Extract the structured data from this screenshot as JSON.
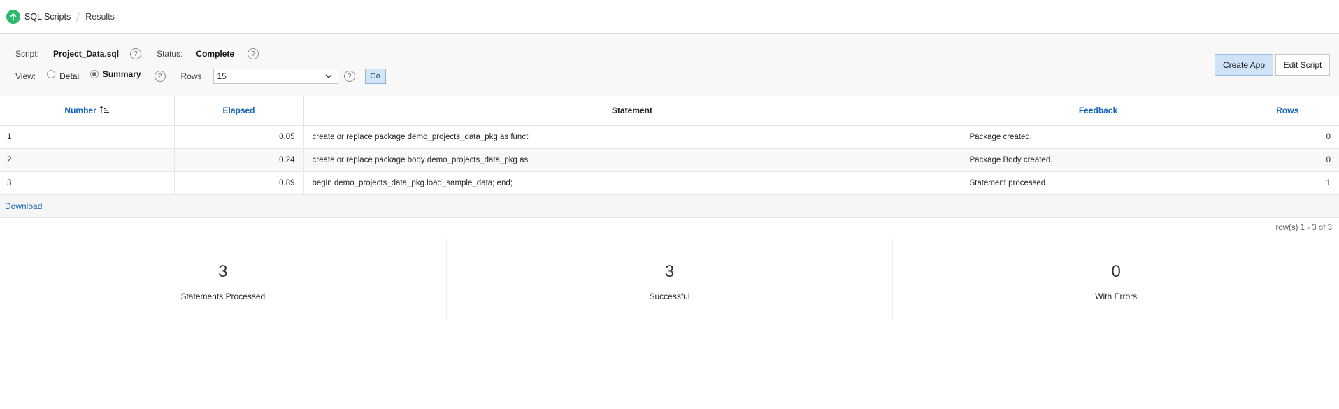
{
  "breadcrumb": {
    "parent": "SQL Scripts",
    "current": "Results"
  },
  "params": {
    "script_label": "Script:",
    "script_value": "Project_Data.sql",
    "status_label": "Status:",
    "status_value": "Complete",
    "view_label": "View:",
    "view_options": [
      "Detail",
      "Summary"
    ],
    "view_selected": "Summary",
    "rows_label": "Rows",
    "rows_value": "15",
    "go_label": "Go",
    "help_glyph": "?"
  },
  "buttons": {
    "create_app": "Create App",
    "edit_script": "Edit Script"
  },
  "table": {
    "columns": [
      "Number",
      "Elapsed",
      "Statement",
      "Feedback",
      "Rows"
    ],
    "sorted_column": "Number",
    "rows": [
      {
        "number": "1",
        "elapsed": "0.05",
        "statement": "create or replace package demo_projects_data_pkg as functi",
        "feedback": "Package created.",
        "rows": "0"
      },
      {
        "number": "2",
        "elapsed": "0.24",
        "statement": "create or replace package body demo_projects_data_pkg as",
        "feedback": "Package Body created.",
        "rows": "0"
      },
      {
        "number": "3",
        "elapsed": "0.89",
        "statement": "begin demo_projects_data_pkg.load_sample_data; end;",
        "feedback": "Statement processed.",
        "rows": "1"
      }
    ]
  },
  "download_label": "Download",
  "pagination_text": "row(s) 1 - 3 of 3",
  "summary": [
    {
      "value": "3",
      "label": "Statements Processed"
    },
    {
      "value": "3",
      "label": "Successful"
    },
    {
      "value": "0",
      "label": "With Errors"
    }
  ],
  "colors": {
    "accent_green": "#2bba6e",
    "link_blue": "#1767b8",
    "primary_button": "#cfe3f6"
  }
}
